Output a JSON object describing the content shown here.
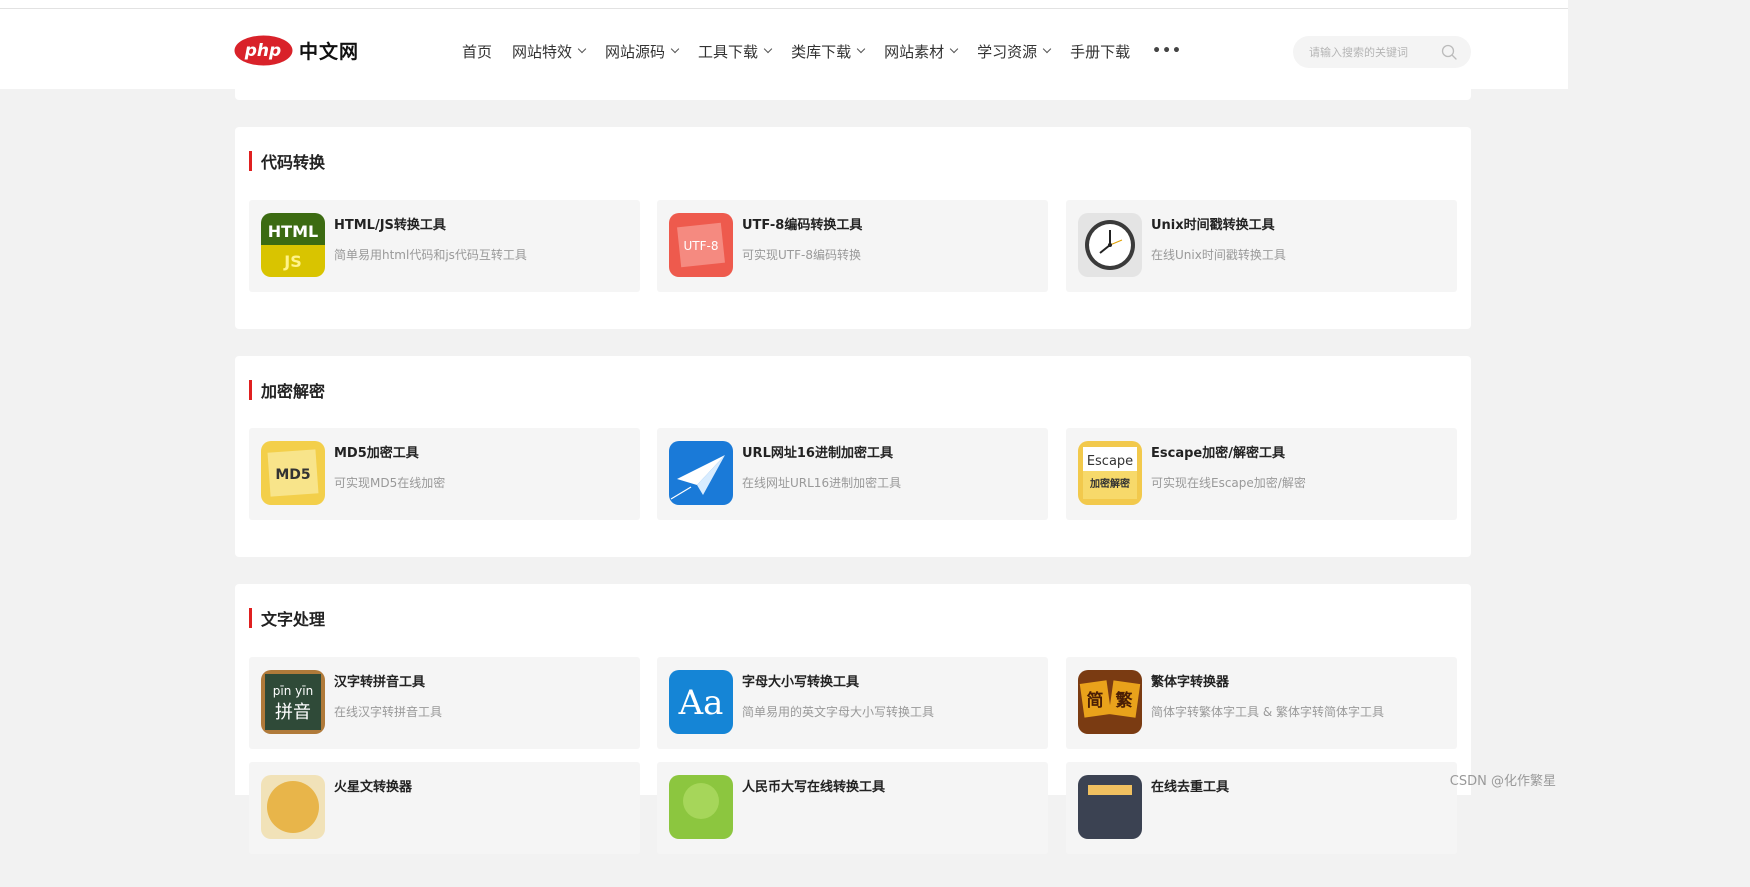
{
  "header": {
    "logo_mark": "php",
    "logo_text": "中文网",
    "nav": [
      {
        "label": "首页",
        "dropdown": false
      },
      {
        "label": "网站特效",
        "dropdown": true
      },
      {
        "label": "网站源码",
        "dropdown": true
      },
      {
        "label": "工具下载",
        "dropdown": true
      },
      {
        "label": "类库下载",
        "dropdown": true
      },
      {
        "label": "网站素材",
        "dropdown": true
      },
      {
        "label": "学习资源",
        "dropdown": true
      },
      {
        "label": "手册下载",
        "dropdown": false
      }
    ],
    "more_label": "•••",
    "search_placeholder": "请输入搜索的关键词"
  },
  "sections": [
    {
      "title": "代码转换",
      "tools": [
        {
          "name": "HTML/JS转换工具",
          "desc": "简单易用html代码和js代码互转工具",
          "icon": "html-js-icon",
          "icon_text": [
            "HTML",
            "JS"
          ]
        },
        {
          "name": "UTF-8编码转换工具",
          "desc": "可实现UTF-8编码转换",
          "icon": "utf8-icon",
          "icon_text": [
            "UTF-8"
          ]
        },
        {
          "name": "Unix时间戳转换工具",
          "desc": "在线Unix时间戳转换工具",
          "icon": "clock-icon",
          "icon_text": []
        }
      ]
    },
    {
      "title": "加密解密",
      "tools": [
        {
          "name": "MD5加密工具",
          "desc": "可实现MD5在线加密",
          "icon": "md5-note-icon",
          "icon_text": [
            "MD5"
          ]
        },
        {
          "name": "URL网址16进制加密工具",
          "desc": "在线网址URL16进制加密工具",
          "icon": "paper-plane-icon",
          "icon_text": []
        },
        {
          "name": "Escape加密/解密工具",
          "desc": "可实现在线Escape加密/解密",
          "icon": "escape-icon",
          "icon_text": [
            "Escape",
            "加密解密"
          ]
        }
      ]
    },
    {
      "title": "文字处理",
      "tools": [
        {
          "name": "汉字转拼音工具",
          "desc": "在线汉字转拼音工具",
          "icon": "pinyin-board-icon",
          "icon_text": [
            "pīn yīn",
            "拼音"
          ]
        },
        {
          "name": "字母大小写转换工具",
          "desc": "简单易用的英文字母大小写转换工具",
          "icon": "letter-case-icon",
          "icon_text": [
            "Aa"
          ]
        },
        {
          "name": "繁体字转换器",
          "desc": "简体字转繁体字工具 & 繁体字转简体字工具",
          "icon": "jian-fan-icon",
          "icon_text": [
            "简",
            "繁"
          ]
        },
        {
          "name": "火星文转换器",
          "desc": "",
          "icon": "mars-text-icon",
          "icon_text": []
        },
        {
          "name": "人民币大写在线转换工具",
          "desc": "",
          "icon": "rmb-icon",
          "icon_text": []
        },
        {
          "name": "在线去重工具",
          "desc": "",
          "icon": "dedupe-icon",
          "icon_text": []
        }
      ]
    }
  ],
  "watermark": "CSDN @化作繁星",
  "colors": {
    "accent": "#e02020",
    "logo_red": "#d9222a",
    "card_bg": "#f5f5f5",
    "page_bg": "#f2f2f2"
  }
}
